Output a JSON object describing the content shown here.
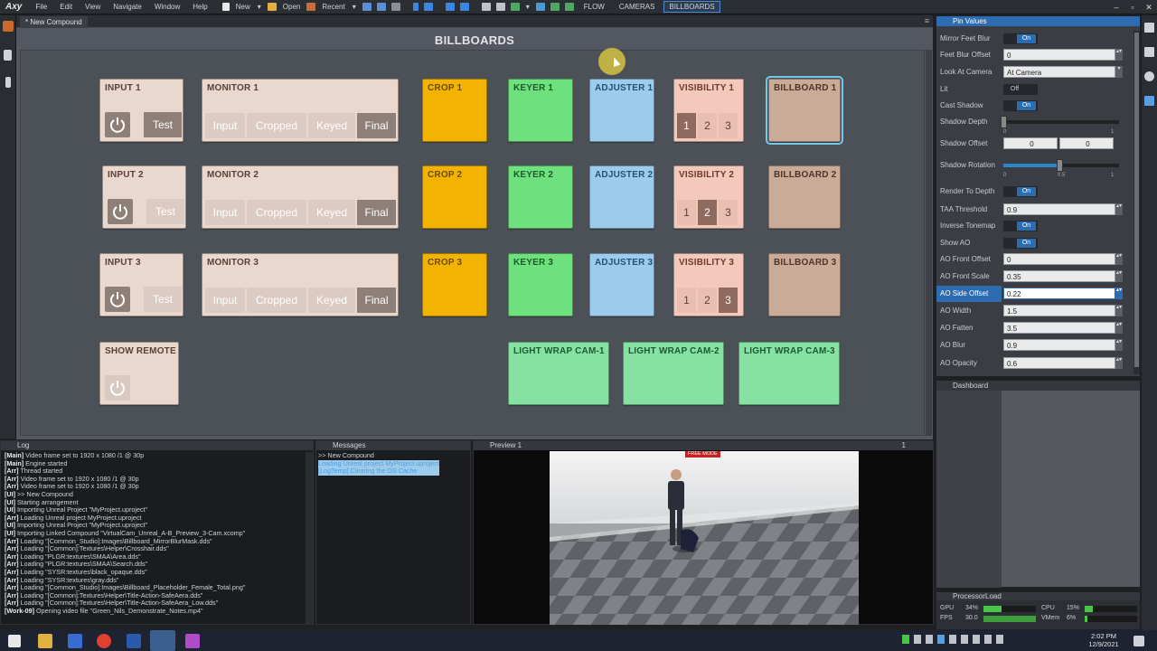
{
  "app": {
    "logo": "Aximmetry",
    "menu": [
      "File",
      "Edit",
      "View",
      "Navigate",
      "Window",
      "Help"
    ],
    "toolbar": {
      "new": "New",
      "open": "Open",
      "recent": "Recent"
    },
    "flow_buttons": [
      "FLOW",
      "CAMERAS",
      "BILLBOARDS"
    ],
    "active_flow": "BILLBOARDS"
  },
  "main_tab": {
    "label": "* New Compound"
  },
  "canvas": {
    "title": "BILLBOARDS",
    "inputs": [
      {
        "title": "INPUT 1",
        "test": "Test"
      },
      {
        "title": "INPUT 2",
        "test": "Test"
      },
      {
        "title": "INPUT 3",
        "test": "Test"
      }
    ],
    "monitors": [
      {
        "title": "MONITOR 1",
        "buttons": [
          "Input",
          "Cropped",
          "Keyed",
          "Final"
        ],
        "active": "Final"
      },
      {
        "title": "MONITOR 2",
        "buttons": [
          "Input",
          "Cropped",
          "Keyed",
          "Final"
        ],
        "active": "Final"
      },
      {
        "title": "MONITOR 3",
        "buttons": [
          "Input",
          "Cropped",
          "Keyed",
          "Final"
        ],
        "active": "Final"
      }
    ],
    "crops": [
      "CROP 1",
      "CROP 2",
      "CROP 3"
    ],
    "keyers": [
      "KEYER 1",
      "KEYER 2",
      "KEYER 3"
    ],
    "adjusters": [
      "ADJUSTER 1",
      "ADJUSTER 2",
      "ADJUSTER 3"
    ],
    "visibility": [
      {
        "title": "VISIBILITY 1",
        "buttons": [
          "1",
          "2",
          "3"
        ],
        "active": "1"
      },
      {
        "title": "VISIBILITY 2",
        "buttons": [
          "1",
          "2",
          "3"
        ],
        "active": "2"
      },
      {
        "title": "VISIBILITY 3",
        "buttons": [
          "1",
          "2",
          "3"
        ],
        "active": "3"
      }
    ],
    "billboards": [
      "BILLBOARD 1",
      "BILLBOARD 2",
      "BILLBOARD 3"
    ],
    "selected_billboard": "BILLBOARD 1",
    "show_remote": "SHOW REMOTE",
    "light_wraps": [
      "LIGHT WRAP CAM-1",
      "LIGHT WRAP CAM-2",
      "LIGHT WRAP CAM-3"
    ]
  },
  "pin_values": {
    "header": "Pin Values",
    "rows": [
      {
        "label": "Mirror Feet Blur",
        "type": "toggle",
        "value": "On"
      },
      {
        "label": "Feet Blur Offset",
        "type": "number",
        "value": "0"
      },
      {
        "label": "Look At Camera",
        "type": "select",
        "value": "At Camera"
      },
      {
        "label": "Lit",
        "type": "toggle",
        "value": "Off"
      },
      {
        "label": "Cast Shadow",
        "type": "toggle",
        "value": "On"
      },
      {
        "label": "Shadow Depth",
        "type": "slider",
        "value": 0,
        "tick_min": "0",
        "tick_max": "1"
      },
      {
        "label": "Shadow Offset",
        "type": "pair",
        "value": [
          "0",
          "0"
        ]
      },
      {
        "label": "Shadow Rotation",
        "type": "slider",
        "value": 0.5,
        "tick_min": "0",
        "tick_mid": "0.5",
        "tick_max": "1"
      },
      {
        "label": "Render To Depth",
        "type": "toggle",
        "value": "On"
      },
      {
        "label": "TAA Threshold",
        "type": "number",
        "value": "0.9"
      },
      {
        "label": "Inverse Tonemap",
        "type": "toggle",
        "value": "On"
      },
      {
        "label": "Show AO",
        "type": "toggle",
        "value": "On"
      },
      {
        "label": "AO Front Offset",
        "type": "number",
        "value": "0"
      },
      {
        "label": "AO Front Scale",
        "type": "number",
        "value": "0.35"
      },
      {
        "label": "AO Side Offset",
        "type": "number",
        "value": "0.22",
        "highlight": true
      },
      {
        "label": "AO Width",
        "type": "number",
        "value": "1.5"
      },
      {
        "label": "AO Fatten",
        "type": "number",
        "value": "3.5"
      },
      {
        "label": "AO Blur",
        "type": "number",
        "value": "0.9"
      },
      {
        "label": "AO Opacity",
        "type": "number",
        "value": "0.6"
      }
    ]
  },
  "dashboard": {
    "header": "Dashboard"
  },
  "processor_load": {
    "header": "ProcessorLoad",
    "gpu_label": "GPU",
    "gpu_value": "34%",
    "gpu_level": 0.34,
    "cpu_label": "CPU",
    "cpu_value": "15%",
    "cpu_level": 0.15,
    "fps_label": "FPS",
    "fps_value": "30.0",
    "vmem_label": "VMem",
    "vmem_value": "6%",
    "vmem_level": 0.06
  },
  "log": {
    "header": "Log",
    "lines": [
      [
        "[Main]",
        " Video frame set to 1920 x 1080 /1 @ 30p"
      ],
      [
        "[Main]",
        " Engine started"
      ],
      [
        "[Arr]",
        " Thread started"
      ],
      [
        "[Arr]",
        " Video frame set to 1920 x 1080 /1 @ 30p"
      ],
      [
        "[Arr]",
        " Video frame set to 1920 x 1080 /1 @ 30p"
      ],
      [
        "[UI]",
        " >> New Compound"
      ],
      [
        "[UI]",
        " Starting arrangement"
      ],
      [
        "[UI]",
        " Importing Unreal Project \"MyProject.uproject\""
      ],
      [
        "[Arr]",
        " Loading Unreal project MyProject.uproject"
      ],
      [
        "[UI]",
        " Importing Unreal Project \"MyProject.uproject\""
      ],
      [
        "[UI]",
        " Importing Linked Compound \"VirtualCam_Unreal_A-B_Preview_3-Cam.xcomp\""
      ],
      [
        "[Arr]",
        " Loading \"[Common_Studio]:Images\\Billboard_MirrorBlurMask.dds\""
      ],
      [
        "[Arr]",
        " Loading \"[Common]:Textures\\Helper\\Crosshair.dds\""
      ],
      [
        "[Arr]",
        " Loading \"PLGR:textures\\SMAA\\Area.dds\""
      ],
      [
        "[Arr]",
        " Loading \"PLGR:textures\\SMAA\\Search.dds\""
      ],
      [
        "[Arr]",
        " Loading \"SYSR:textures\\black_opaque.dds\""
      ],
      [
        "[Arr]",
        " Loading \"SYSR:textures\\gray.dds\""
      ],
      [
        "[Arr]",
        " Loading \"[Common_Studio]:Images\\Billboard_Placeholder_Female_Total.png\""
      ],
      [
        "[Arr]",
        " Loading \"[Common]:Textures\\Helper\\Title-Action-SafeAera.dds\""
      ],
      [
        "[Arr]",
        " Loading \"[Common]:Textures\\Helper\\Title-Action-SafeAera_Low.dds\""
      ],
      [
        "[Work-09]",
        " Opening video file \"Green_Nils_Demonstrate_Notes.mp4\""
      ]
    ]
  },
  "messages": {
    "header": "Messages",
    "lines": [
      ">> New Compound",
      "Loading Unreal project MyProject.uproject",
      "[LogTemp] Clearing the OS Cache"
    ]
  },
  "preview": {
    "header": "Preview 1",
    "index": "1",
    "badge": "FREE MODE"
  },
  "taskbar": {
    "time": "2:02 PM",
    "date": "12/9/2021"
  },
  "colors": {
    "accent": "#2d6cb1",
    "selection": "#6fc9ea"
  }
}
